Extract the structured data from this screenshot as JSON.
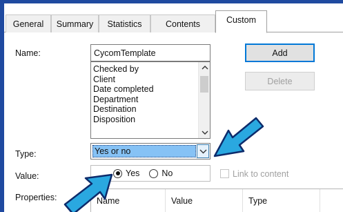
{
  "tabs": [
    {
      "label": "General"
    },
    {
      "label": "Summary"
    },
    {
      "label": "Statistics"
    },
    {
      "label": "Contents"
    },
    {
      "label": "Custom"
    }
  ],
  "name": {
    "label": "Name:",
    "value": "CycomTemplate"
  },
  "name_list": [
    "Checked by",
    "Client",
    "Date completed",
    "Department",
    "Destination",
    "Disposition"
  ],
  "buttons": {
    "add": "Add",
    "delete": "Delete"
  },
  "type": {
    "label": "Type:",
    "value": "Yes or no"
  },
  "value": {
    "label": "Value:",
    "yes": "Yes",
    "no": "No",
    "selected": "Yes"
  },
  "link_to_content": "Link to content",
  "properties": {
    "label": "Properties:",
    "columns": [
      "Name",
      "Value",
      "Type"
    ]
  },
  "colors": {
    "frame_background": "#1f4aa0",
    "arrow_fill": "#2aa8e0",
    "selection": "#86c2f5",
    "default_button_border": "#0078d7"
  }
}
